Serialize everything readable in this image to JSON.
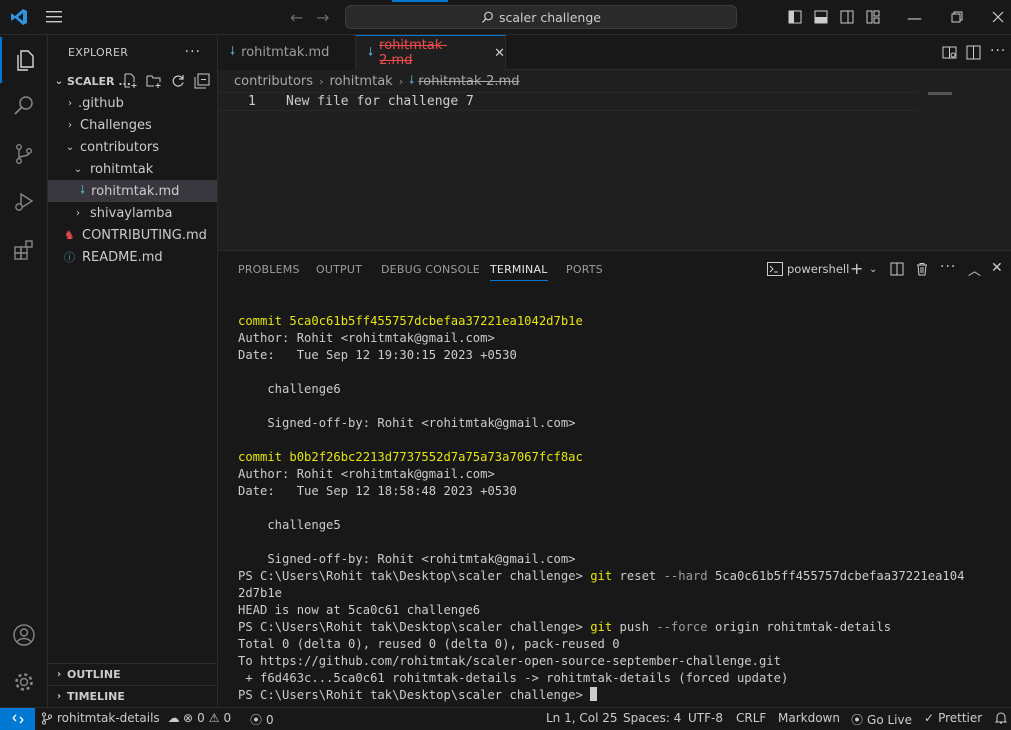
{
  "titlebar": {
    "search_text": "scaler challenge",
    "nav_back": "←",
    "nav_forward": "→"
  },
  "sidebar": {
    "header": "EXPLORER",
    "more": "···",
    "root_folder": "SCALER ...",
    "tree": [
      {
        "label": ".github",
        "type": "folder",
        "expanded": false
      },
      {
        "label": "Challenges",
        "type": "folder",
        "expanded": false
      },
      {
        "label": "contributors",
        "type": "folder",
        "expanded": true
      },
      {
        "label": "rohitmtak",
        "type": "folder",
        "expanded": true
      },
      {
        "label": "rohitmtak.md",
        "type": "file",
        "selected": true
      },
      {
        "label": "shivaylamba",
        "type": "folder",
        "expanded": false
      },
      {
        "label": "CONTRIBUTING.md",
        "type": "file"
      },
      {
        "label": "README.md",
        "type": "file"
      }
    ],
    "outline": "OUTLINE",
    "timeline": "TIMELINE"
  },
  "tabs": [
    {
      "label": "rohitmtak.md",
      "active": false
    },
    {
      "label": "rohitmtak-2.md",
      "active": true,
      "deleted": true
    }
  ],
  "breadcrumb": [
    "contributors",
    "rohitmtak",
    "rohitmtak-2.md"
  ],
  "editor": {
    "line_number": "1",
    "line_text": "New file for challenge 7"
  },
  "panel": {
    "tabs": [
      "PROBLEMS",
      "OUTPUT",
      "DEBUG CONSOLE",
      "TERMINAL",
      "PORTS"
    ],
    "active_tab": "TERMINAL",
    "terminal_name": "powershell",
    "terminal": {
      "commit1_hash": "commit 5ca0c61b5ff455757dcbefaa37221ea1042d7b1e",
      "commit1_author": "Author: Rohit <rohitmtak@gmail.com>",
      "commit1_date": "Date:   Tue Sep 12 19:30:15 2023 +0530",
      "commit1_msg": "    challenge6",
      "commit1_signoff": "    Signed-off-by: Rohit <rohitmtak@gmail.com>",
      "commit2_hash": "commit b0b2f26bc2213d7737552d7a75a73a7067fcf8ac",
      "commit2_author": "Author: Rohit <rohitmtak@gmail.com>",
      "commit2_date": "Date:   Tue Sep 12 18:58:48 2023 +0530",
      "commit2_msg": "    challenge5",
      "commit2_signoff": "    Signed-off-by: Rohit <rohitmtak@gmail.com>",
      "prompt": "PS C:\\Users\\Rohit tak\\Desktop\\scaler challenge> ",
      "cmd_git": "git",
      "reset_cmd1": " reset ",
      "reset_flag": "--hard",
      "reset_cmd2": " 5ca0c61b5ff455757dcbefaa37221ea104",
      "reset_wrap": "2d7b1e",
      "head_msg": "HEAD is now at 5ca0c61 challenge6",
      "push_cmd1": " push ",
      "push_flag": "--force",
      "push_cmd2": " origin rohitmtak-details",
      "push_total": "Total 0 (delta 0), reused 0 (delta 0), pack-reused 0",
      "push_to": "To https://github.com/rohitmtak/scaler-open-source-september-challenge.git",
      "push_result": " + f6d463c...5ca0c61 rohitmtak-details -> rohitmtak-details (forced update)"
    }
  },
  "statusbar": {
    "branch": "rohitmtak-details",
    "errors": "0",
    "warnings": "0",
    "ports": "0",
    "position": "Ln 1, Col 25",
    "spaces": "Spaces: 4",
    "encoding": "UTF-8",
    "eol": "CRLF",
    "language": "Markdown",
    "golive": "Go Live",
    "prettier": "Prettier"
  },
  "colors": {
    "accent": "#0078d4",
    "terminal_yellow": "#e5e510",
    "deleted_red": "#f14c4c"
  }
}
